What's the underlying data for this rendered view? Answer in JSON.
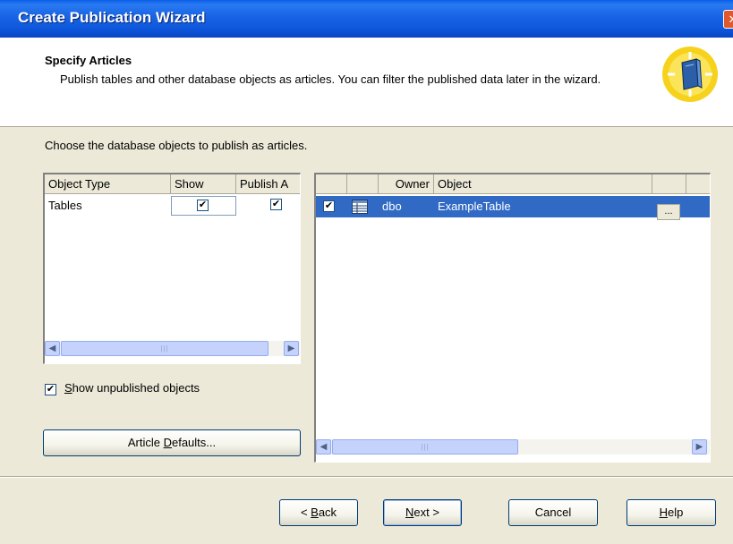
{
  "window": {
    "title": "Create Publication Wizard",
    "close_glyph": "✕"
  },
  "header": {
    "title": "Specify Articles",
    "description": "Publish tables and other database objects as articles. You can filter the published data later in the wizard."
  },
  "instruction": "Choose the database objects to publish as articles.",
  "left_grid": {
    "columns": [
      "Object Type",
      "Show",
      "Publish A"
    ],
    "rows": [
      {
        "object_type": "Tables",
        "show": true,
        "publish_all": true
      }
    ]
  },
  "right_grid": {
    "columns": [
      "",
      "",
      "Owner",
      "Object",
      ""
    ],
    "rows": [
      {
        "checked": true,
        "icon": "table-icon",
        "owner": "dbo",
        "object": "ExampleTable",
        "ellipsis": "..."
      }
    ]
  },
  "show_unpublished": {
    "label_pre": "",
    "label_accel": "S",
    "label_post": "how unpublished objects",
    "checked": true
  },
  "article_defaults": {
    "label_pre": "Article ",
    "label_accel": "D",
    "label_post": "efaults..."
  },
  "buttons": {
    "back": {
      "pre": "< ",
      "accel": "B",
      "post": "ack"
    },
    "next": {
      "pre": "",
      "accel": "N",
      "post": "ext >"
    },
    "cancel": "Cancel",
    "help": {
      "pre": "",
      "accel": "H",
      "post": "elp"
    }
  },
  "colors": {
    "title_bar": "#0a5ee8",
    "selection": "#316ac5",
    "dialog_bg": "#ece9d8"
  },
  "glyphs": {
    "check": "✔",
    "scroll_left": "◀",
    "scroll_right": "▶",
    "thumb_grip": "|||"
  }
}
